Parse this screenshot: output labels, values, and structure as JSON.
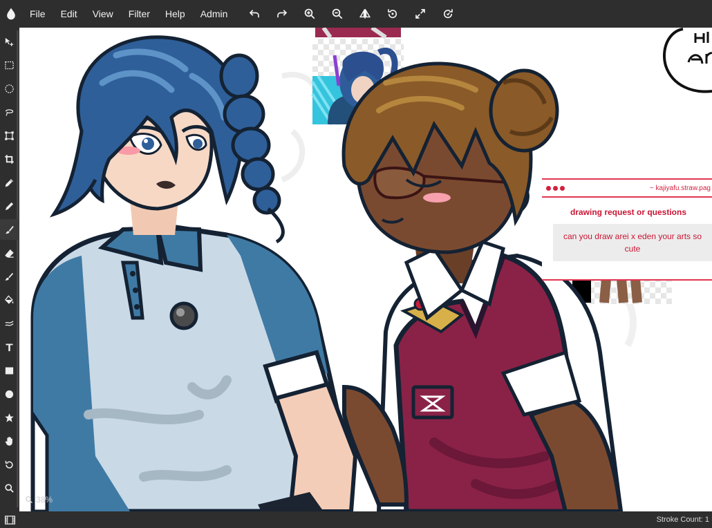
{
  "menu": {
    "items": [
      "File",
      "Edit",
      "View",
      "Filter",
      "Help",
      "Admin"
    ]
  },
  "toolbar": {
    "icons": [
      "undo-icon",
      "redo-icon",
      "zoom-in-icon",
      "zoom-out-icon",
      "flip-icon",
      "rotate-icon",
      "fullscreen-icon",
      "reset-rotation-icon"
    ]
  },
  "tools": [
    "move-icon",
    "rect-select-icon",
    "ellipse-select-icon",
    "lasso-icon",
    "transform-icon",
    "crop-icon",
    "eyedropper-icon",
    "pen-icon",
    "brush-icon",
    "eraser-icon",
    "smudge-icon",
    "fill-icon",
    "blur-icon",
    "text-icon",
    "rectangle-icon",
    "circle-icon",
    "shape-icon",
    "hand-icon",
    "rotate-view-icon",
    "zoom-icon"
  ],
  "canvas": {
    "zoom_label": "38%"
  },
  "ask_card": {
    "url": "~ kajiyafu.straw.pag",
    "title": "drawing request or questions",
    "message": "can you draw arei x eden your arts so cute"
  },
  "status": {
    "stroke_count": "Stroke Count: 1"
  },
  "colors": {
    "accent": "#e0344f",
    "chrome": "#2e2e2e"
  }
}
